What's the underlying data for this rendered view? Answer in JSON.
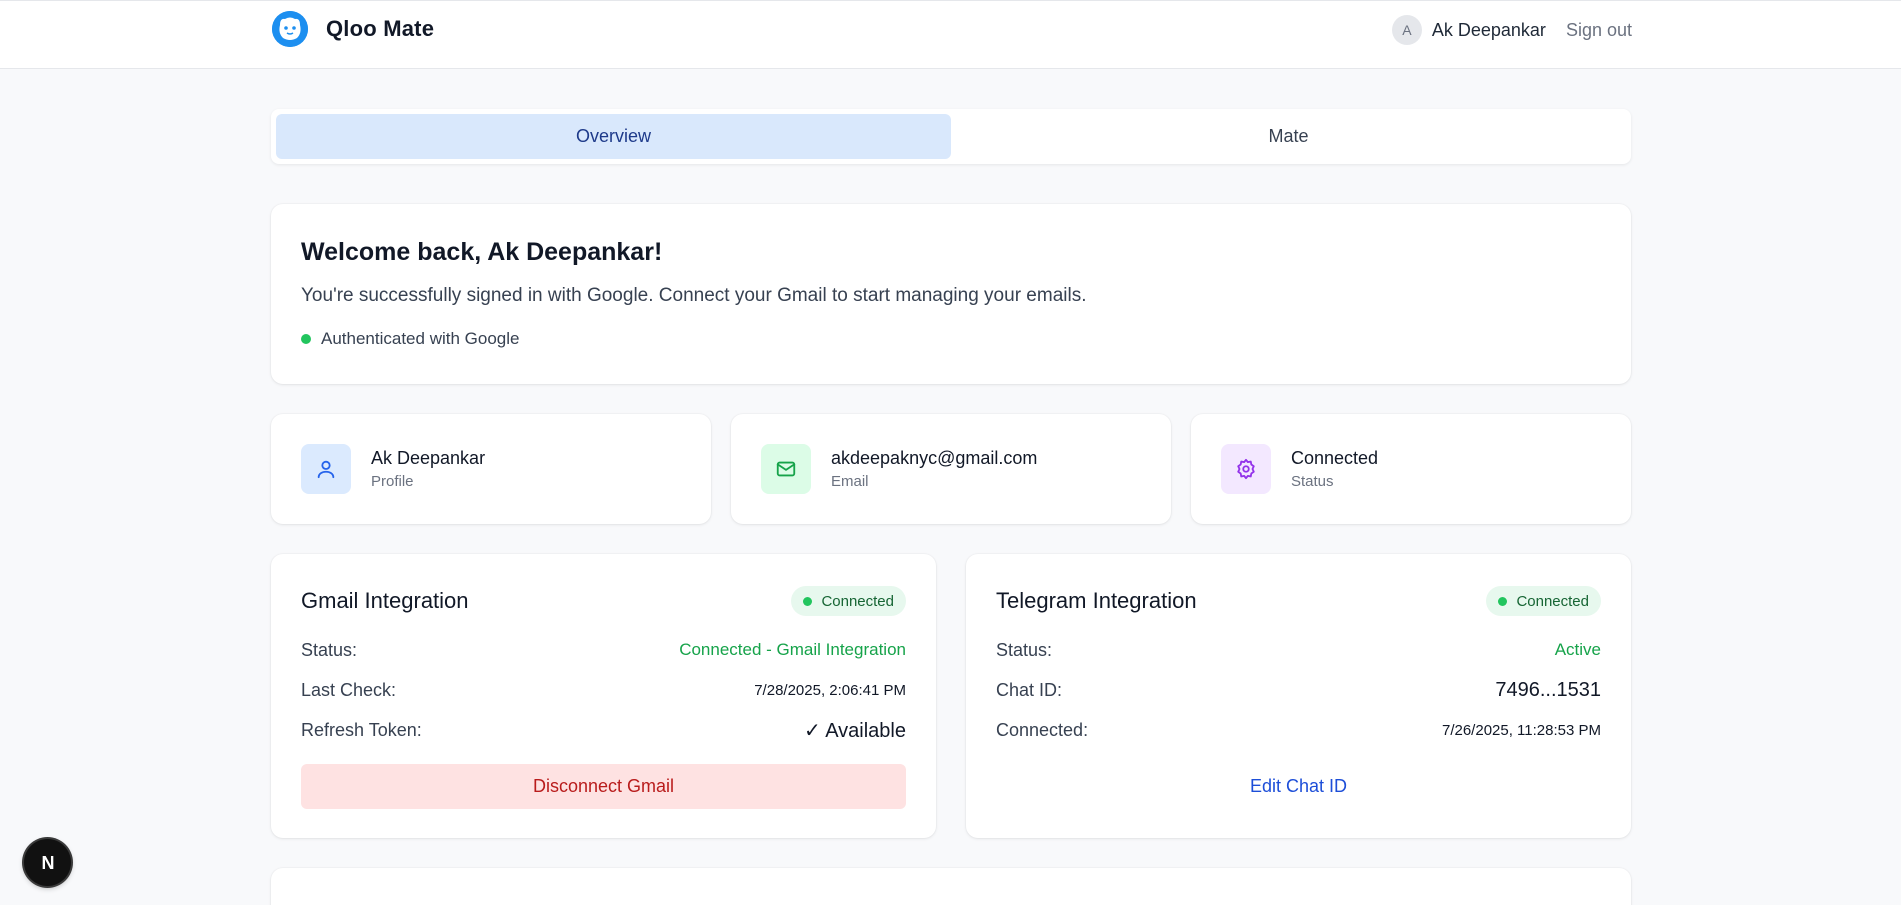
{
  "header": {
    "brand": "Qloo Mate",
    "avatar_initial": "A",
    "user_name": "Ak Deepankar",
    "signout_label": "Sign out"
  },
  "tabs": [
    {
      "label": "Overview",
      "active": true
    },
    {
      "label": "Mate",
      "active": false
    }
  ],
  "welcome": {
    "title": "Welcome back, Ak Deepankar!",
    "message": "You're successfully signed in with Google. Connect your Gmail to start managing your emails.",
    "auth_status": "Authenticated with Google"
  },
  "info_cards": [
    {
      "title": "Ak Deepankar",
      "subtitle": "Profile",
      "icon": "user-icon",
      "color": "#2563eb",
      "bg": "#dbeafe"
    },
    {
      "title": "akdeepaknyc@gmail.com",
      "subtitle": "Email",
      "icon": "mail-icon",
      "color": "#16a34a",
      "bg": "#dcfce7"
    },
    {
      "title": "Connected",
      "subtitle": "Status",
      "icon": "gear-icon",
      "color": "#9333ea",
      "bg": "#f3e8ff"
    }
  ],
  "gmail": {
    "title": "Gmail Integration",
    "badge": "Connected",
    "status_label": "Status:",
    "status_value": "Connected - Gmail Integration",
    "last_check_label": "Last Check:",
    "last_check_value": "7/28/2025, 2:06:41 PM",
    "refresh_label": "Refresh Token:",
    "refresh_value": "✓ Available",
    "disconnect_label": "Disconnect Gmail"
  },
  "telegram": {
    "title": "Telegram Integration",
    "badge": "Connected",
    "status_label": "Status:",
    "status_value": "Active",
    "chat_label": "Chat ID:",
    "chat_value": "7496...1531",
    "connected_label": "Connected:",
    "connected_value": "7/26/2025, 11:28:53 PM",
    "edit_label": "Edit Chat ID"
  },
  "dev_badge": "N",
  "colors": {
    "accent": "#1d8ff0",
    "tab_active_bg": "#d9e8fc",
    "success": "#22c55e",
    "danger_bg": "#fee2e2",
    "danger_text": "#b91c1c",
    "link": "#1d4ed8"
  }
}
